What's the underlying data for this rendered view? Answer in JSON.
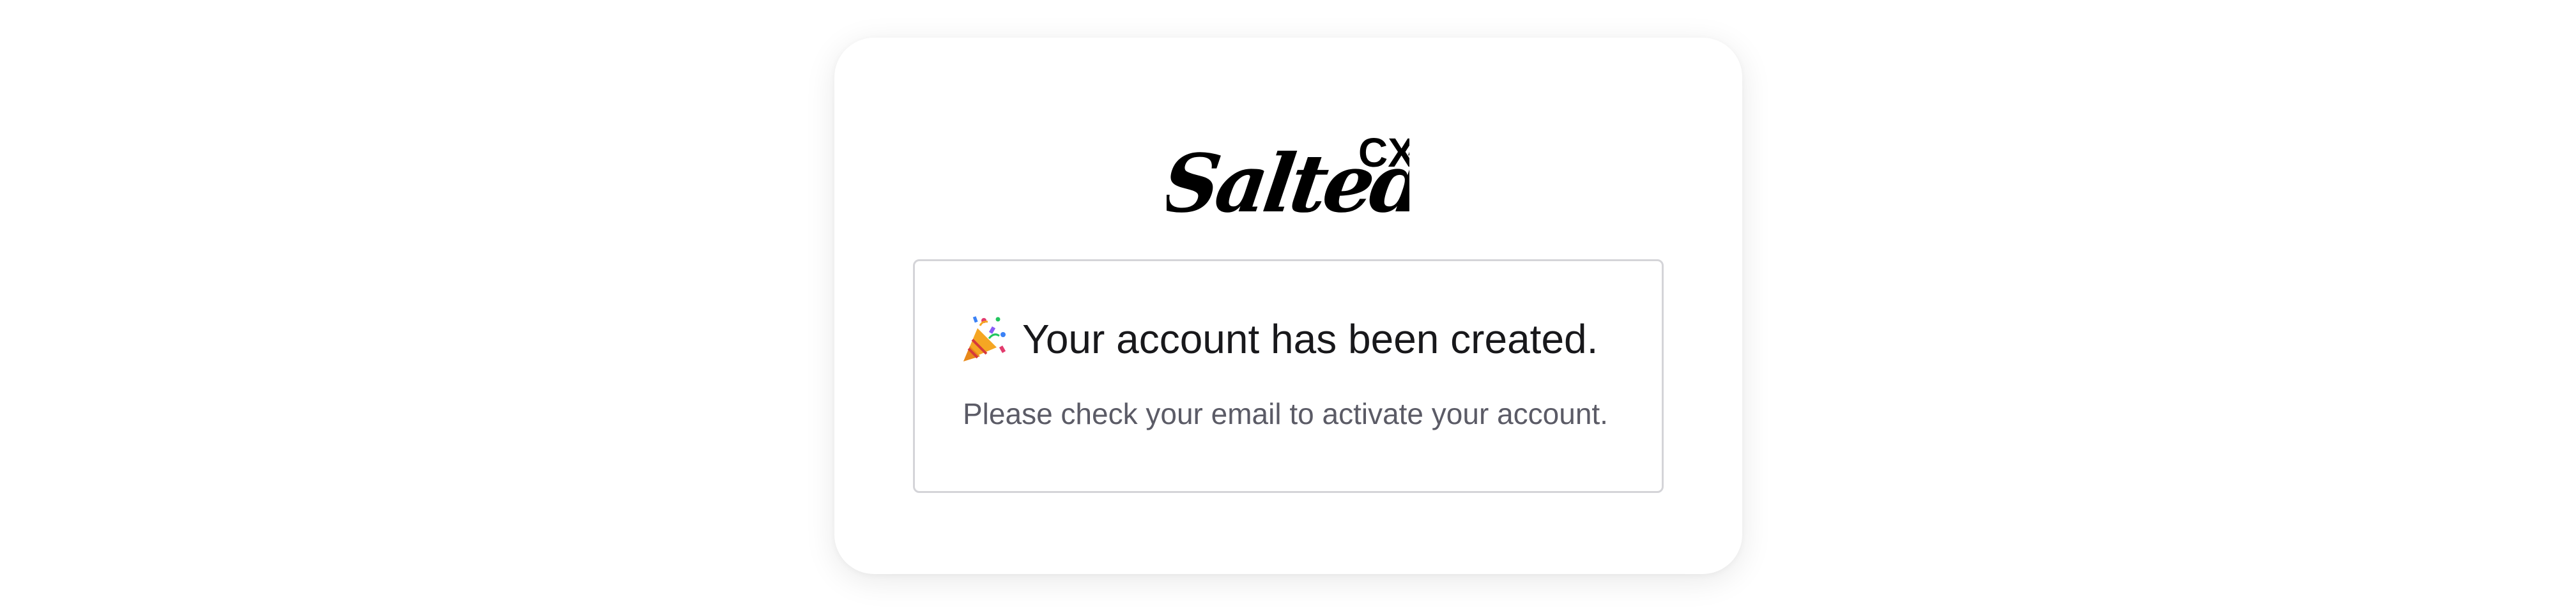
{
  "brand": {
    "logo_text": "Salted",
    "logo_superscript": "CX",
    "logo_color": "#000000"
  },
  "notice": {
    "icon": "party-popper-icon",
    "title": "Your account has been created.",
    "message": "Please check your email to activate your account.",
    "border_color": "#d4d4d8"
  }
}
